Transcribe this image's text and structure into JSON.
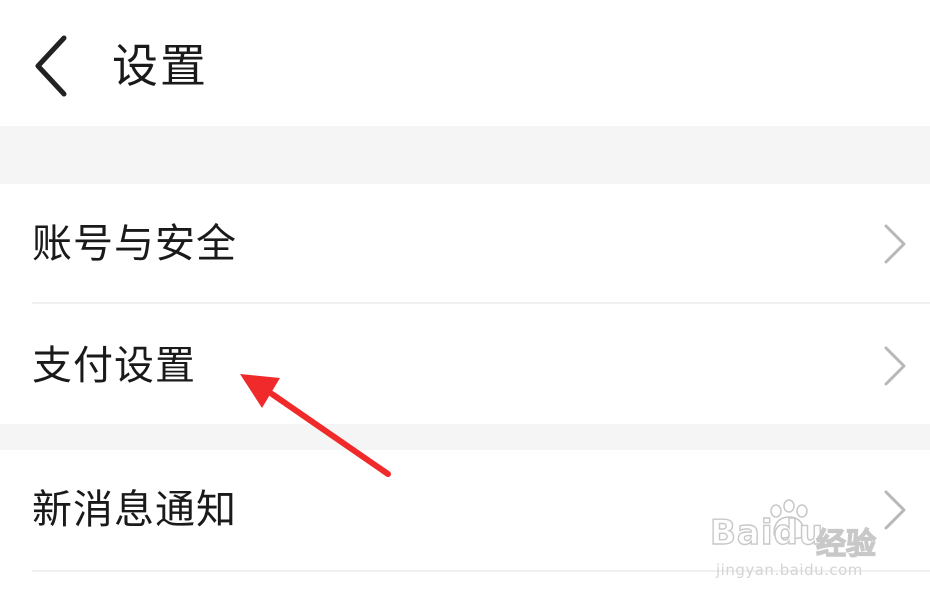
{
  "header": {
    "title": "设置"
  },
  "menu": {
    "items": [
      {
        "label": "账号与安全"
      },
      {
        "label": "支付设置"
      },
      {
        "label": "新消息通知"
      }
    ]
  },
  "annotation": {
    "arrow_color": "#f02a2a"
  },
  "watermark": {
    "brand": "Baidu",
    "product": "经验",
    "url": "jingyan.baidu.com"
  },
  "icons": {
    "back": "chevron-left-icon",
    "row_arrow": "chevron-right-icon"
  }
}
